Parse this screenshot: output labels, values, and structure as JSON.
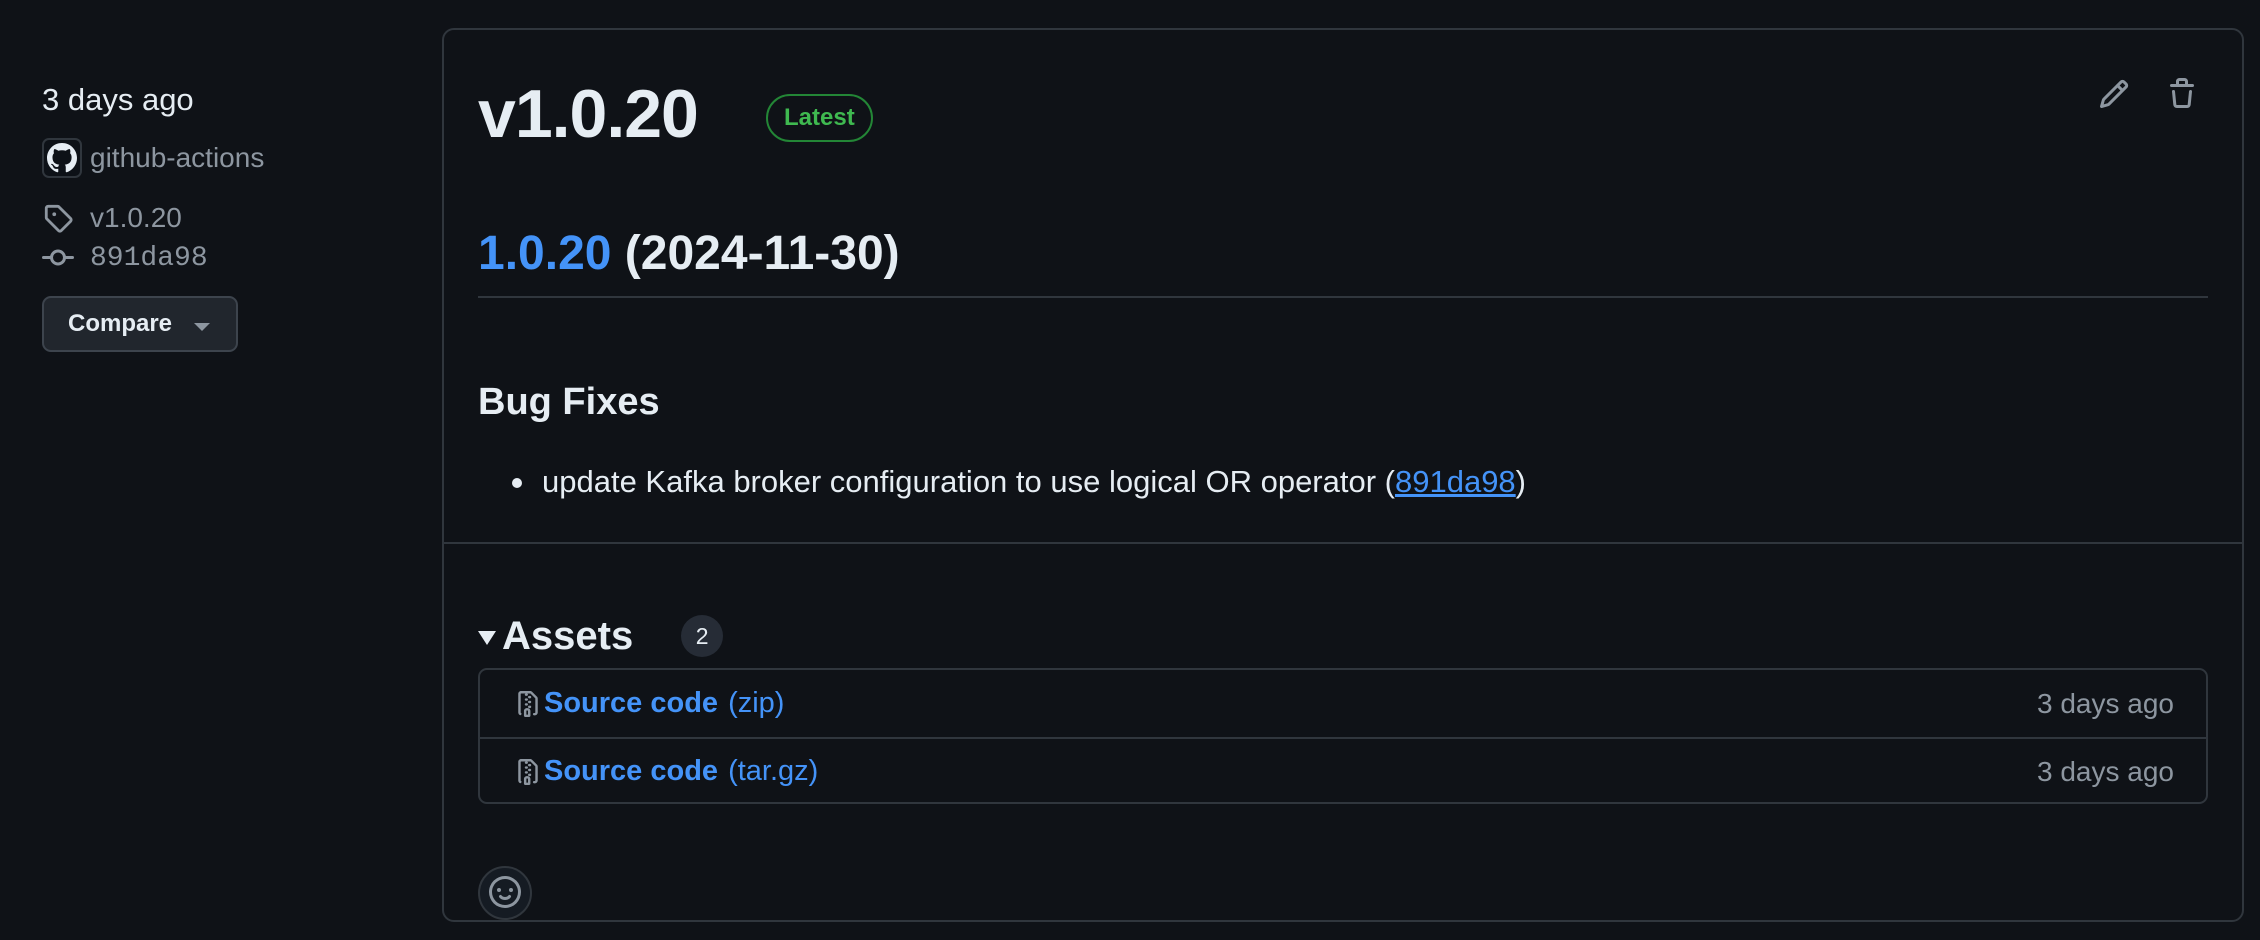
{
  "sidebar": {
    "time_ago": "3 days ago",
    "author": "github-actions",
    "tag": "v1.0.20",
    "commit": "891da98",
    "compare_label": "Compare"
  },
  "release": {
    "title": "v1.0.20",
    "badge": "Latest",
    "version_link": "1.0.20",
    "version_date": "(2024-11-30)",
    "section": "Bug Fixes",
    "changes": [
      {
        "text": "update Kafka broker configuration to use logical OR operator (",
        "commit": "891da98",
        "suffix": ")"
      }
    ]
  },
  "assets": {
    "title": "Assets",
    "count": "2",
    "items": [
      {
        "name": "Source code",
        "ext": "(zip)",
        "time": "3 days ago"
      },
      {
        "name": "Source code",
        "ext": "(tar.gz)",
        "time": "3 days ago"
      }
    ]
  },
  "icons": {
    "avatar": "github-mark-icon",
    "tag": "tag-icon",
    "commit": "git-commit-icon",
    "edit": "pencil-icon",
    "delete": "trash-icon",
    "asset": "file-zip-icon",
    "reaction": "smiley-icon"
  },
  "colors": {
    "background": "#0f1217",
    "link": "#4493f8",
    "latest_badge": "#3fb950",
    "muted_text": "#8d96a0",
    "border": "#30363d"
  }
}
